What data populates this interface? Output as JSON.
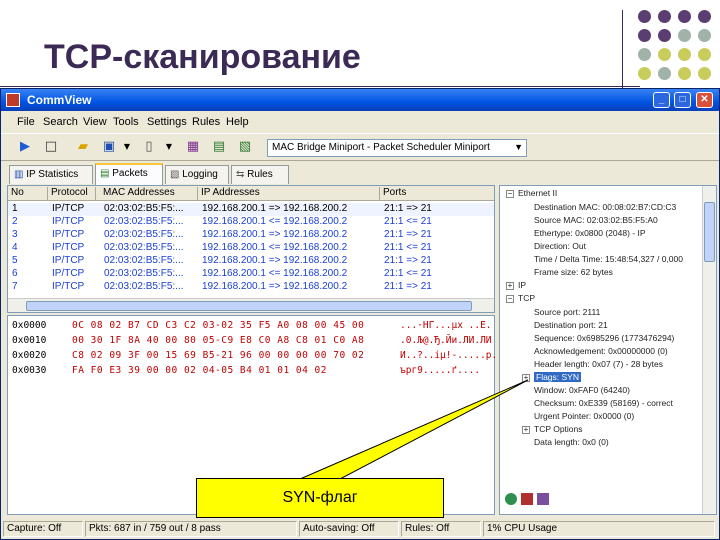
{
  "slide": {
    "title": "TCP-сканирование"
  },
  "dot_colors": [
    "#5b3e71",
    "#5b3e71",
    "#5b3e71",
    "#5b3e71",
    "#5b3e71",
    "#5b3e71",
    "#9fb3a8",
    "#9fb3a8",
    "#9fb3a8",
    "#c8cc5a",
    "#c8cc5a",
    "#c8cc5a",
    "#c8cc5a",
    "#9fb3a8",
    "#c8cc5a",
    "#c8cc5a"
  ],
  "window": {
    "title": "CommView",
    "controls": {
      "minimize": "_",
      "maximize": "□",
      "close": "✕"
    }
  },
  "menu": [
    "File",
    "Search",
    "View",
    "Tools",
    "Settings",
    "Rules",
    "Help"
  ],
  "toolbar": {
    "adapter": "MAC Bridge Miniport - Packet Scheduler Miniport"
  },
  "tabs": [
    "IP Statistics",
    "Packets",
    "Logging",
    "Rules"
  ],
  "packet_list": {
    "columns": [
      "No",
      "Protocol",
      "MAC Addresses",
      "IP Addresses",
      "Ports"
    ],
    "rows": [
      [
        "1",
        "IP/TCP",
        "02:03:02:B5:F5:...",
        "192.168.200.1 => 192.168.200.2",
        "21:1 => 21"
      ],
      [
        "2",
        "IP/TCP",
        "02:03:02:B5:F5:...",
        "192.168.200.1 <= 192.168.200.2",
        "21:1 <= 21"
      ],
      [
        "3",
        "IP/TCP",
        "02:03:02:B5:F5:...",
        "192.168.200.1 => 192.168.200.2",
        "21:1 => 21"
      ],
      [
        "4",
        "IP/TCP",
        "02:03:02:B5:F5:...",
        "192.168.200.1 <= 192.168.200.2",
        "21:1 <= 21"
      ],
      [
        "5",
        "IP/TCP",
        "02:03:02:B5:F5:...",
        "192.168.200.1 => 192.168.200.2",
        "21:1 => 21"
      ],
      [
        "6",
        "IP/TCP",
        "02:03:02:B5:F5:...",
        "192.168.200.1 <= 192.168.200.2",
        "21:1 <= 21"
      ],
      [
        "7",
        "IP/TCP",
        "02:03:02:B5:F5:...",
        "192.168.200.1 => 192.168.200.2",
        "21:1 => 21"
      ]
    ]
  },
  "hex_dump": [
    {
      "offset": "0x0000",
      "bytes": "0C 08 02 B7 CD C3 C2 03-02 35 F5 A0 08 00 45 00",
      "ascii": "...·НГ...µх ..E."
    },
    {
      "offset": "0x0010",
      "bytes": "00 30 1F 8A 40 00 80 05-C9 E8 C0 A8 C8 01 C0 A8",
      "ascii": ".0.Љ@.Ђ.Йи.ЛИ.ЛИ"
    },
    {
      "offset": "0x0020",
      "bytes": "C8 02 09 3F 00 15 69 B5-21 96 00 00 00 00 70 02",
      "ascii": "И..?..iµ!-.....p."
    },
    {
      "offset": "0x0030",
      "bytes": "FA F0 E3 39 00 00 02 04-05 B4 01 01 04 02",
      "ascii": "ърг9.....ґ...."
    }
  ],
  "detail_tree": {
    "ethernet": {
      "label": "Ethernet II",
      "fields": [
        "Destination MAC: 00:08:02:B7:CD:C3",
        "Source MAC: 02:03:02:B5:F5:A0",
        "Ethertype: 0x0800 (2048) - IP",
        "Direction: Out",
        "Time / Delta Time: 15:48:54,327 / 0,000",
        "Frame size: 62 bytes"
      ]
    },
    "ip": {
      "label": "IP"
    },
    "tcp": {
      "label": "TCP",
      "fields": [
        "Source port: 2111",
        "Destination port: 21",
        "Sequence: 0x6985296 (1773476294)",
        "Acknowledgement: 0x00000000 (0)",
        "Header length: 0x07 (7) - 28 bytes"
      ],
      "flags": "Flags: SYN",
      "more_fields": [
        "Window: 0xFAF0 (64240)",
        "Checksum: 0xE339 (58169) - correct",
        "Urgent Pointer: 0x0000 (0)"
      ],
      "options": "TCP Options",
      "data_length": "Data length: 0x0 (0)"
    }
  },
  "annotation": {
    "label": "SYN-флаг",
    "box_color": "#ffff00"
  },
  "statusbar": {
    "capture": "Capture: Off",
    "packets": "Pkts: 687 in / 759 out / 8 pass",
    "autosave": "Auto-saving: Off",
    "rules": "Rules: Off",
    "cpu": "1% CPU Usage"
  }
}
